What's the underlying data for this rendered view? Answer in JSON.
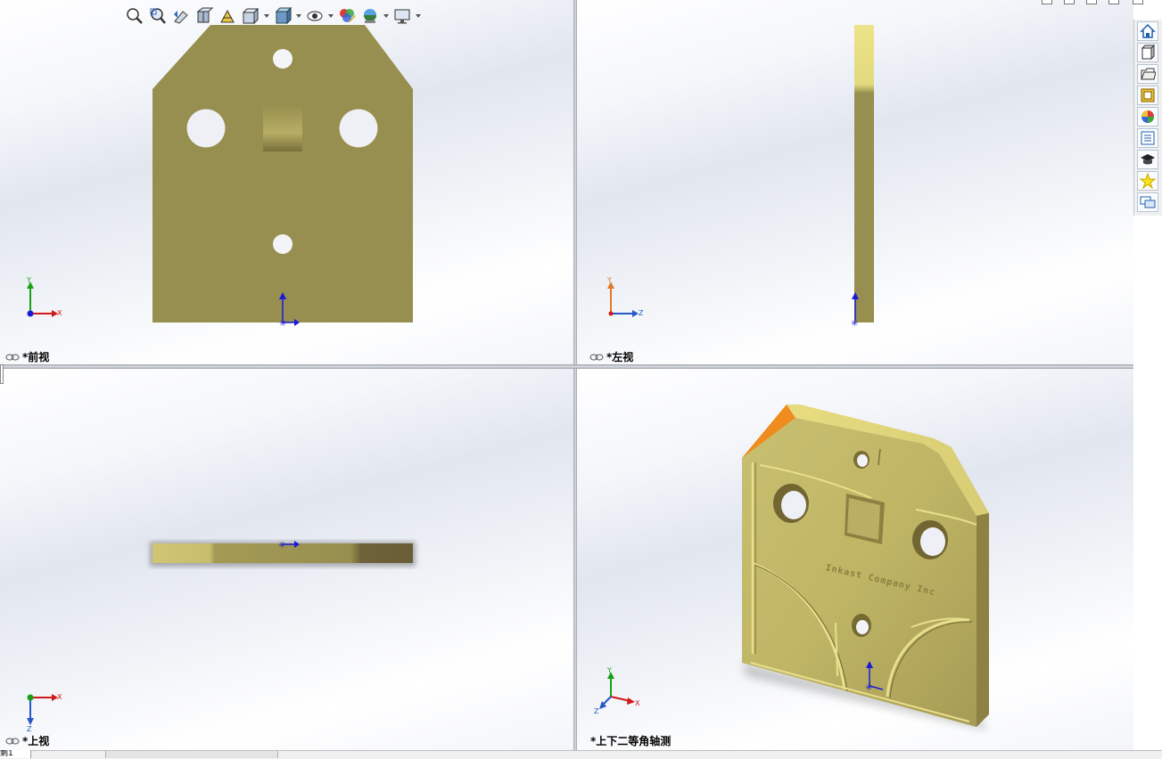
{
  "viewports": {
    "front": {
      "label": "*前视",
      "triad": {
        "y": "Y",
        "x": "X"
      }
    },
    "left": {
      "label": "*左视",
      "triad": {
        "y": "Y",
        "z": "Z"
      }
    },
    "top": {
      "label": "*上视",
      "triad": {
        "x": "X",
        "z": "Z"
      }
    },
    "iso": {
      "label": "*上下二等角轴测",
      "triad": {
        "y": "Y",
        "x": "X",
        "z": "Z"
      }
    }
  },
  "part": {
    "engraved_text": "Inkast Company Inc",
    "colors": {
      "body": "#9a9350",
      "highlight": "#e6dd85",
      "edge": "#f08b1e",
      "shadow": "#6b5f3a"
    }
  },
  "toolbar": {
    "icons": [
      "zoom-to-fit-icon",
      "zoom-to-area-icon",
      "previous-view-icon",
      "section-view-icon",
      "dynamic-annotation-icon",
      "view-orientation-icon",
      "display-style-icon",
      "hide-show-items-icon",
      "edit-appearance-icon",
      "apply-scene-icon",
      "view-settings-icon"
    ]
  },
  "taskpane": {
    "icons": [
      "home-icon",
      "design-library-icon",
      "file-explorer-icon",
      "view-palette-icon",
      "appearances-icon",
      "custom-properties-icon",
      "tutorials-icon",
      "favorites-star-icon",
      "forum-icon"
    ]
  },
  "statusbar": {
    "sheet_tab": "剩1"
  }
}
